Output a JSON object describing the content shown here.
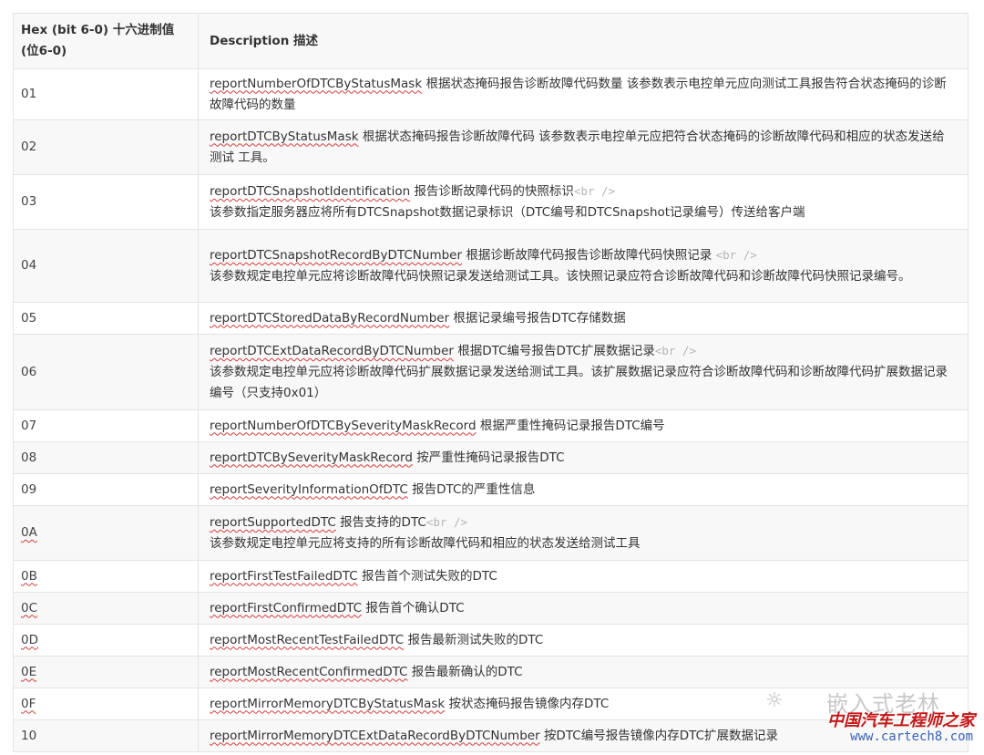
{
  "header": {
    "hex": "Hex (bit 6-0) 十六进制值 (位6-0)",
    "desc": "Description 描述"
  },
  "br_tag": "<br />",
  "rows": [
    {
      "hex": "01",
      "name": "reportNumberOfDTCByStatusMask",
      "text": "根据状态掩码报告诊断故障代码数量 该参数表示电控单元应向测试工具报告符合状态掩码的诊断故障代码的数量"
    },
    {
      "hex": "02",
      "name": "reportDTCByStatusMask",
      "text": "根据状态掩码报告诊断故障代码 该参数表示电控单元应把符合状态掩码的诊断故障代码和相应的状态发送给测试 工具。"
    },
    {
      "hex": "03",
      "name": "reportDTCSnapshotIdentification",
      "text": "报告诊断故障代码的快照标识",
      "text2": "该参数指定服务器应将所有DTCSnapshot数据记录标识（DTC编号和DTCSnapshot记录编号）传送给客户端"
    },
    {
      "hex": "04",
      "name": "reportDTCSnapshotRecordByDTCNumber",
      "text": "根据诊断故障代码报告诊断故障代码快照记录",
      "text2": "该参数规定电控单元应将诊断故障代码快照记录发送给测试工具。该快照记录应符合诊断故障代码和诊断故障代码快照记录编号。"
    },
    {
      "hex": "05",
      "name": "reportDTCStoredDataByRecordNumber",
      "text": "根据记录编号报告DTC存储数据"
    },
    {
      "hex": "06",
      "name": "reportDTCExtDataRecordByDTCNumber",
      "text": "根据DTC编号报告DTC扩展数据记录",
      "text2": "该参数规定电控单元应将诊断故障代码扩展数据记录发送给测试工具。该扩展数据记录应符合诊断故障代码和诊断故障代码扩展数据记录编号（只支持0x01）"
    },
    {
      "hex": "07",
      "name": "reportNumberOfDTCBySeverityMaskRecord",
      "text": "根据严重性掩码记录报告DTC编号"
    },
    {
      "hex": "08",
      "name": "reportDTCBySeverityMaskRecord",
      "text": "按严重性掩码记录报告DTC"
    },
    {
      "hex": "09",
      "name": "reportSeverityInformationOfDTC",
      "text": "报告DTC的严重性信息"
    },
    {
      "hex": "0A",
      "name": "reportSupportedDTC",
      "text": "报告支持的DTC",
      "text2": "该参数规定电控单元应将支持的所有诊断故障代码和相应的状态发送给测试工具"
    },
    {
      "hex": "0B",
      "name": "reportFirstTestFailedDTC",
      "text": "报告首个测试失败的DTC"
    },
    {
      "hex": "0C",
      "name": "reportFirstConfirmedDTC",
      "text": "报告首个确认DTC"
    },
    {
      "hex": "0D",
      "name": "reportMostRecentTestFailedDTC",
      "text": "报告最新测试失败的DTC"
    },
    {
      "hex": "0E",
      "name": "reportMostRecentConfirmedDTC",
      "text": "报告最新确认的DTC"
    },
    {
      "hex": "0F",
      "name": "reportMirrorMemoryDTCByStatusMask",
      "text": "按状态掩码报告镜像内存DTC"
    },
    {
      "hex": "10",
      "name": "reportMirrorMemoryDTCExtDataRecordByDTCNumber",
      "text": "按DTC编号报告镜像内存DTC扩展数据记录"
    }
  ],
  "watermark": {
    "account": "嵌入式老林",
    "site_name": "中国汽车工程师之家",
    "url": "www.cartech8.com"
  }
}
